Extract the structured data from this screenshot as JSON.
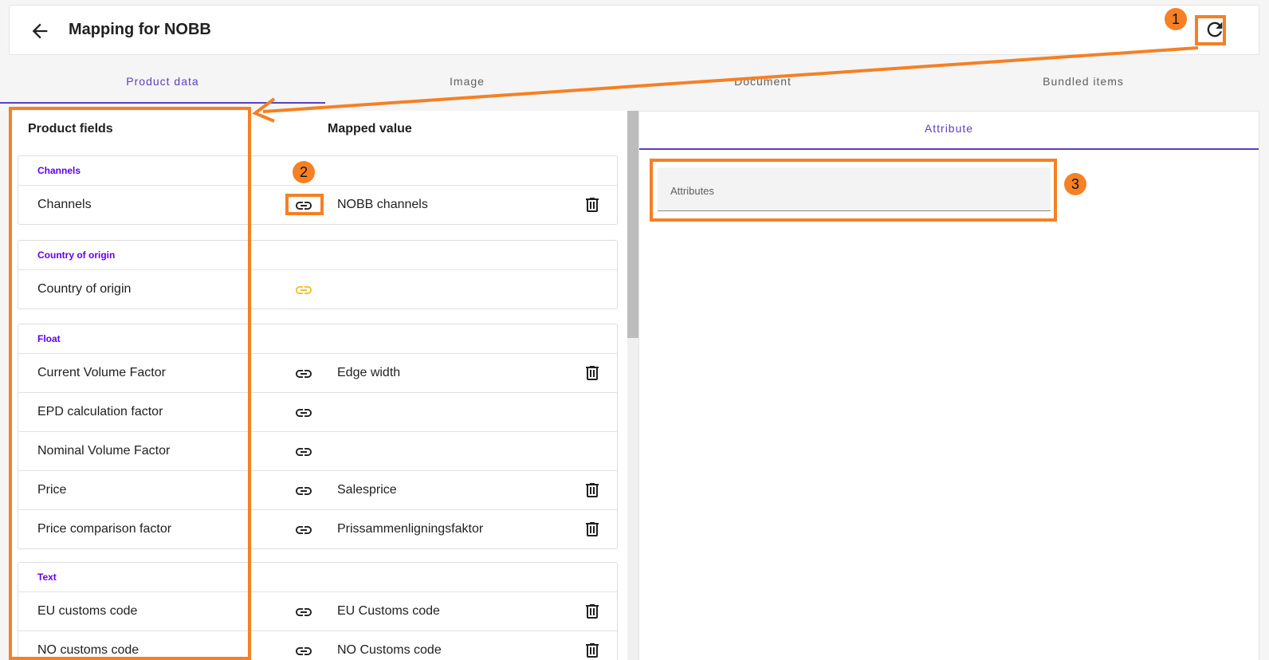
{
  "header": {
    "title": "Mapping for NOBB"
  },
  "tabs": [
    {
      "label": "Product data",
      "active": true
    },
    {
      "label": "Image",
      "active": false
    },
    {
      "label": "Document",
      "active": false
    },
    {
      "label": "Bundled items",
      "active": false
    }
  ],
  "columns": {
    "fields": "Product fields",
    "mapped": "Mapped value"
  },
  "groups": [
    {
      "title": "Channels",
      "rows": [
        {
          "field": "Channels",
          "mapped": "NOBB channels",
          "link_color": "#212121"
        }
      ]
    },
    {
      "title": "Country of origin",
      "rows": [
        {
          "field": "Country of origin",
          "mapped": "",
          "link_color": "#f0c030"
        }
      ]
    },
    {
      "title": "Float",
      "rows": [
        {
          "field": "Current Volume Factor",
          "mapped": "Edge width",
          "link_color": "#212121"
        },
        {
          "field": "EPD calculation factor",
          "mapped": "",
          "link_color": "#212121"
        },
        {
          "field": "Nominal Volume Factor",
          "mapped": "",
          "link_color": "#212121"
        },
        {
          "field": "Price",
          "mapped": "Salesprice",
          "link_color": "#212121"
        },
        {
          "field": "Price comparison factor",
          "mapped": "Prissammenligningsfaktor",
          "link_color": "#212121"
        }
      ]
    },
    {
      "title": "Text",
      "rows": [
        {
          "field": "EU customs code",
          "mapped": "EU Customs code",
          "link_color": "#212121"
        },
        {
          "field": "NO customs code",
          "mapped": "NO Customs code",
          "link_color": "#212121"
        }
      ]
    }
  ],
  "right_panel": {
    "tab": "Attribute",
    "field_label": "Attributes"
  },
  "annotations": {
    "badges": [
      "1",
      "2",
      "3"
    ],
    "color": "#f58025"
  },
  "icons": [
    "back-arrow-icon",
    "refresh-icon",
    "link-icon",
    "trash-icon"
  ]
}
